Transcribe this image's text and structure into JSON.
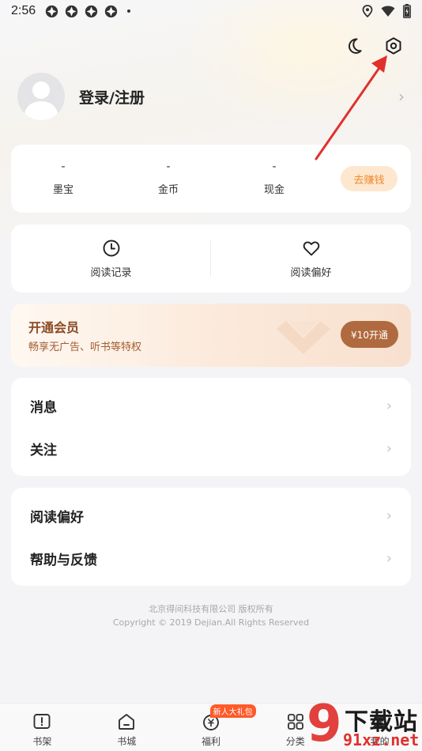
{
  "status_bar": {
    "time": "2:56"
  },
  "header": {
    "night_mode_icon": "moon-icon",
    "settings_icon": "gear-icon"
  },
  "profile": {
    "login_label": "登录/注册"
  },
  "wallet": {
    "items": [
      {
        "value": "-",
        "label": "墨宝"
      },
      {
        "value": "-",
        "label": "金币"
      },
      {
        "value": "-",
        "label": "现金"
      }
    ],
    "earn_button": "去赚钱"
  },
  "quick": {
    "items": [
      {
        "label": "阅读记录",
        "icon": "clock-icon"
      },
      {
        "label": "阅读偏好",
        "icon": "heart-icon"
      }
    ]
  },
  "vip": {
    "title": "开通会员",
    "subtitle": "畅享无广告、听书等特权",
    "button": "¥10开通"
  },
  "menu1": {
    "items": [
      {
        "label": "消息"
      },
      {
        "label": "关注"
      }
    ]
  },
  "menu2": {
    "items": [
      {
        "label": "阅读偏好"
      },
      {
        "label": "帮助与反馈"
      }
    ]
  },
  "footer": {
    "line1": "北京得间科技有限公司 版权所有",
    "line2": "Copyright © 2019 Dejian.All Rights Reserved"
  },
  "bottom_nav": {
    "items": [
      {
        "label": "书架",
        "icon": "bookshelf-icon"
      },
      {
        "label": "书城",
        "icon": "home-icon"
      },
      {
        "label": "福利",
        "icon": "coin-icon",
        "badge": "新人大礼包"
      },
      {
        "label": "分类",
        "icon": "grid-icon"
      },
      {
        "label": "我的",
        "icon": "user-icon"
      }
    ]
  },
  "watermark": {
    "big": "9",
    "top_text": "下载站",
    "bottom_text": "91xz.net"
  },
  "colors": {
    "accent_orange": "#f08a2c",
    "vip_brown": "#b06a3f",
    "annotation_red": "#e0312d"
  }
}
